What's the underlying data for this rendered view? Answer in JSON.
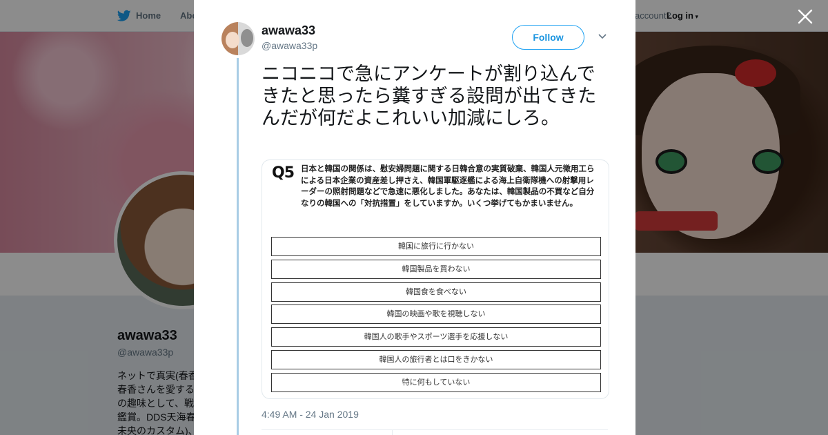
{
  "topbar": {
    "home_label": "Home",
    "about_label": "Abo",
    "account_text": "account?",
    "login_label": "Log in"
  },
  "profile": {
    "name": "awawa33",
    "handle": "@awawa33p",
    "bio": "ネットで真実(春香\n春香さんを愛する\nの趣味として、戦\n鑑賞。DDS天海春\n未央のカスタム)、"
  },
  "tweet": {
    "user_name": "awawa33",
    "user_handle": "@awawa33p",
    "follow_label": "Follow",
    "text": "ニコニコで急にアンケートが割り込んできたと思ったら糞すぎる設問が出てきたんだが何だよこれいい加減にしろ。",
    "timestamp": "4:49 AM - 24 Jan 2019",
    "media": {
      "q_label": "Q5",
      "question": "日本と韓国の関係は、慰安婦問題に関する日韓合意の実質破棄、韓国人元徴用工らによる日本企業の資産差し押さえ、韓国軍駆逐艦による海上自衛隊機への射撃用レーダーの照射問題などで急速に悪化しました。あなたは、韓国製品の不買など自分なりの韓国への「対抗措置」をしていますか。いくつ挙げてもかまいません。",
      "options": [
        "韓国に旅行に行かない",
        "韓国製品を買わない",
        "韓国食を食べない",
        "韓国の映画や歌を視聴しない",
        "韓国人の歌手やスポーツ選手を応援しない",
        "韓国人の旅行者とは口をきかない",
        "特に何もしていない"
      ]
    }
  },
  "icons": {
    "close": "close-icon",
    "twitter": "twitter-bird-icon",
    "caret": "chevron-down-icon"
  },
  "colors": {
    "twitter_blue": "#1da1f2",
    "thread_line": "#a9cde5",
    "text_primary": "#14171a",
    "text_secondary": "#657786"
  }
}
